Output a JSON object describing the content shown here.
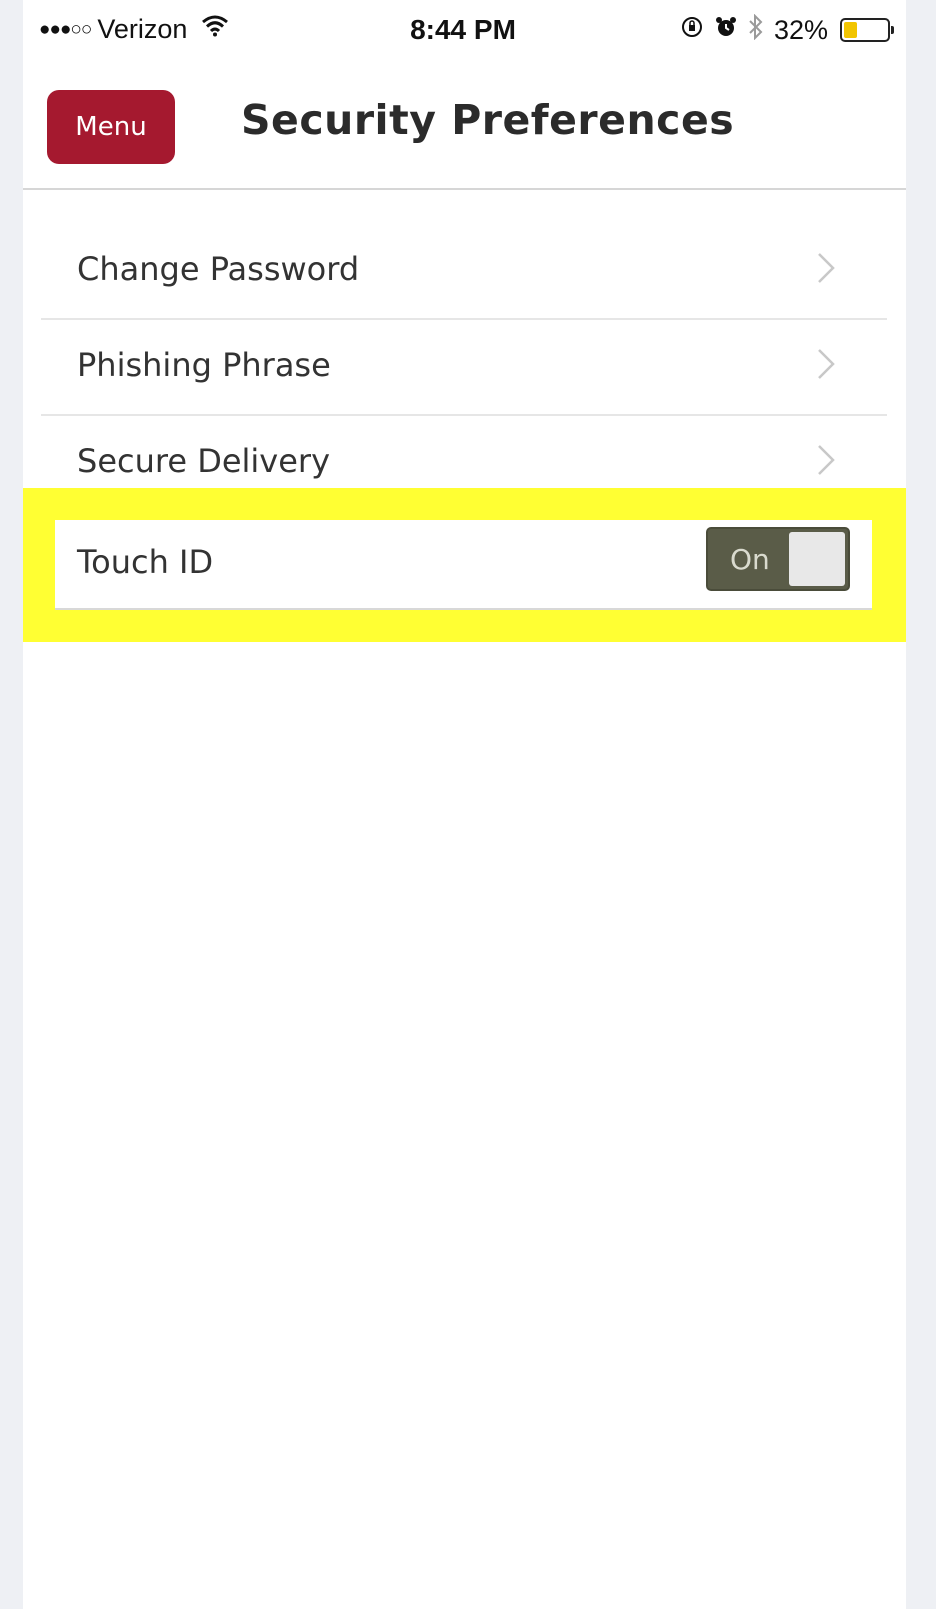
{
  "status_bar": {
    "signal": "●●●○○",
    "carrier": "Verizon",
    "time": "8:44 PM",
    "battery": "32%",
    "battery_level": 0.32
  },
  "header": {
    "menu_label": "Menu",
    "title": "Security Preferences"
  },
  "items": [
    {
      "label": "Change Password"
    },
    {
      "label": "Phishing Phrase"
    },
    {
      "label": "Secure Delivery"
    }
  ],
  "touch_id": {
    "label": "Touch ID",
    "toggle_label": "On",
    "enabled": true
  },
  "colors": {
    "menu_button": "#a5192f",
    "highlight": "#ffff33",
    "toggle_on": "#5a5c48",
    "battery_fill": "#f2c500"
  },
  "icons": {
    "wifi": "wifi-icon",
    "rotation_lock": "rotation-lock-icon",
    "alarm": "alarm-icon",
    "bluetooth": "bluetooth-icon",
    "battery": "battery-icon",
    "chevron": "chevron-right-icon"
  }
}
